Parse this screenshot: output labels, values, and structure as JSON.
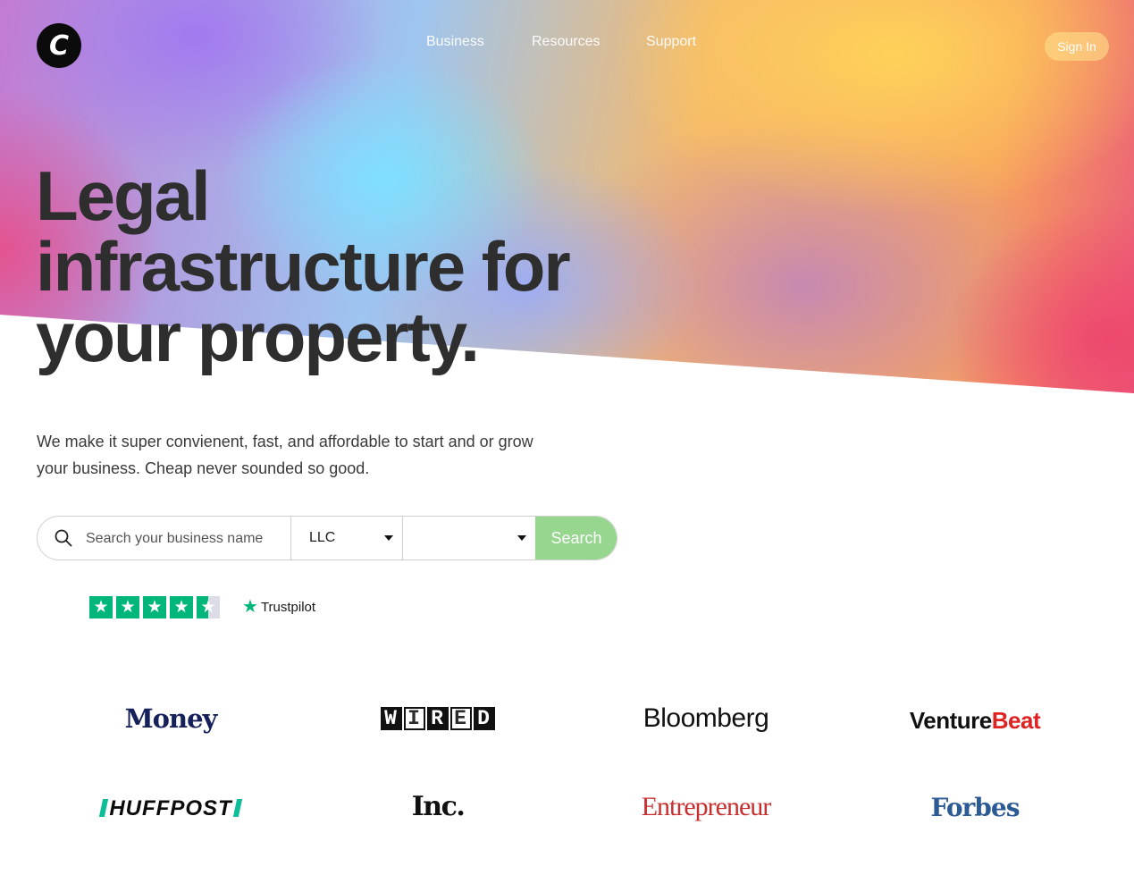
{
  "header": {
    "logo_letter": "C",
    "nav": [
      {
        "label": "Business"
      },
      {
        "label": "Resources"
      },
      {
        "label": "Support"
      }
    ],
    "signin_label": "Sign In"
  },
  "hero": {
    "headline_lines": [
      "Legal",
      "infrastructure for",
      "your property."
    ],
    "subtext": "We make it super convienent, fast, and affordable to start and or grow your business. Cheap never sounded so good."
  },
  "search": {
    "placeholder": "Search your business name",
    "entity_type": "LLC",
    "state_value": "",
    "button_label": "Search"
  },
  "rating": {
    "stars": 4.5,
    "provider": "Trustpilot"
  },
  "press": {
    "money": "Money",
    "wired": [
      "W",
      "I",
      "R",
      "E",
      "D"
    ],
    "bloomberg": "Bloomberg",
    "venturebeat_venture": "Venture",
    "venturebeat_beat": "Beat",
    "huffpost": "HUFFPOST",
    "inc": "Inc.",
    "entrepreneur": "Entrepreneur",
    "forbes": "Forbes"
  },
  "colors": {
    "search_button": "#96d68e",
    "trustpilot_green": "#00b67a",
    "headline": "#2e2e2e"
  }
}
